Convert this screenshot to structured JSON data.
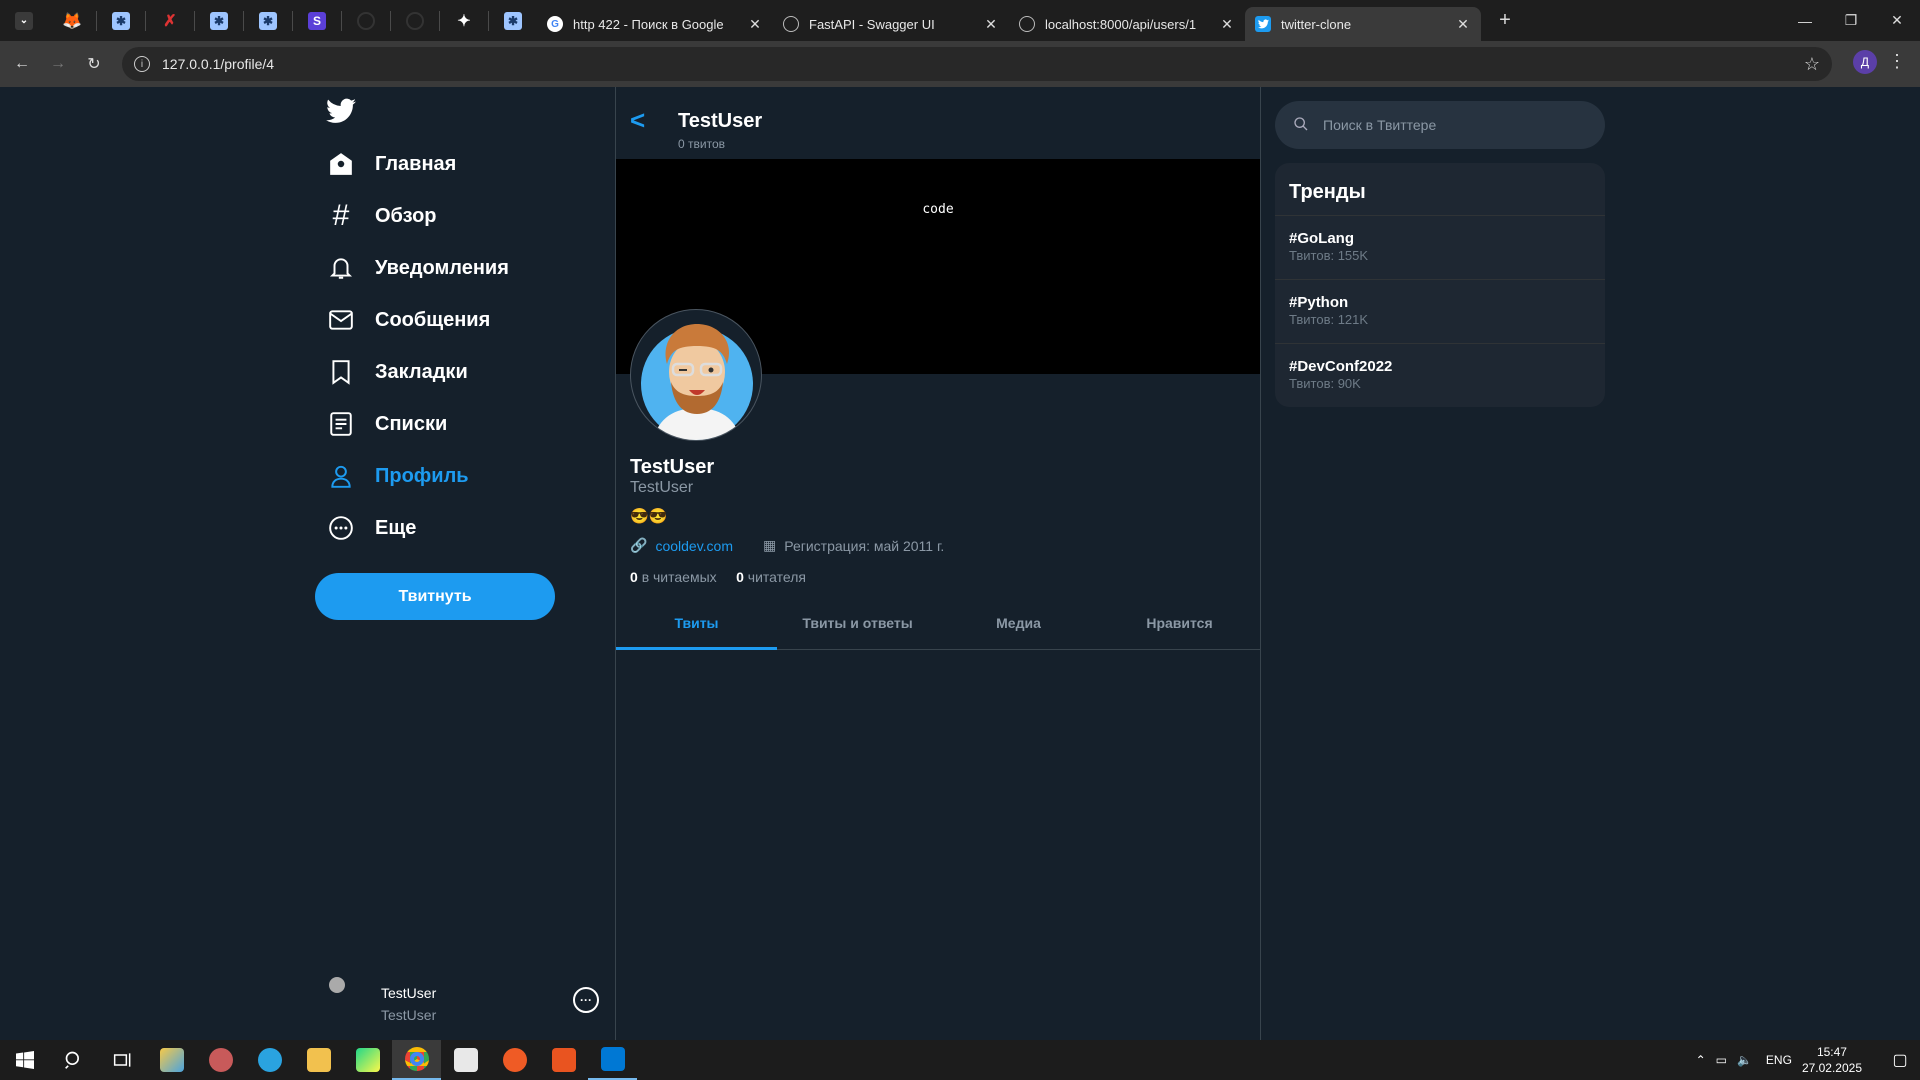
{
  "browser": {
    "tabs": [
      {
        "title": "http 422 - Поиск в Google",
        "favicon": "google-icon"
      },
      {
        "title": "FastAPI - Swagger UI",
        "favicon": "swagger-icon"
      },
      {
        "title": "localhost:8000/api/users/1",
        "favicon": "globe-icon"
      },
      {
        "title": "twitter-clone",
        "favicon": "twitter-icon",
        "active": true
      }
    ],
    "pinned_icons": [
      "tab-list-icon",
      "gitlab-icon",
      "app-icon",
      "x-icon",
      "app-icon",
      "app-icon",
      "s-icon",
      "github-icon",
      "github-icon",
      "sparkle-icon",
      "app-icon"
    ],
    "url": "127.0.0.1/profile/4",
    "profile_letter": "Д"
  },
  "nav": {
    "items": [
      {
        "label": "Главная",
        "icon": "home-icon"
      },
      {
        "label": "Обзор",
        "icon": "hashtag-icon"
      },
      {
        "label": "Уведомления",
        "icon": "bell-icon"
      },
      {
        "label": "Сообщения",
        "icon": "mail-icon"
      },
      {
        "label": "Закладки",
        "icon": "bookmark-icon"
      },
      {
        "label": "Списки",
        "icon": "list-icon"
      },
      {
        "label": "Профиль",
        "icon": "user-icon",
        "active": true
      },
      {
        "label": "Еще",
        "icon": "more-icon"
      }
    ],
    "tweet_button": "Твитнуть",
    "account": {
      "name": "TestUser",
      "handle": "TestUser"
    }
  },
  "profile": {
    "header_name": "TestUser",
    "tweet_count": "0 твитов",
    "banner_text": "code",
    "name": "TestUser",
    "handle": "TestUser",
    "bio": "😎😎",
    "website": "cooldev.com",
    "joined": "Регистрация: май 2011 г.",
    "following_count": "0",
    "following_label": "в читаемых",
    "followers_count": "0",
    "followers_label": "читателя",
    "tabs": [
      "Твиты",
      "Твиты и ответы",
      "Медиа",
      "Нравится"
    ],
    "active_tab": "Твиты"
  },
  "right": {
    "search_placeholder": "Поиск в Твиттере",
    "trends_title": "Тренды",
    "trends": [
      {
        "tag": "#GoLang",
        "count": "Твитов: 155K"
      },
      {
        "tag": "#Python",
        "count": "Твитов: 121K"
      },
      {
        "tag": "#DevConf2022",
        "count": "Твитов: 90K"
      }
    ]
  },
  "taskbar": {
    "lang": "ENG",
    "time": "15:47",
    "date": "27.02.2025"
  },
  "colors": {
    "accent": "#1d9bf0",
    "background": "#15202b"
  }
}
